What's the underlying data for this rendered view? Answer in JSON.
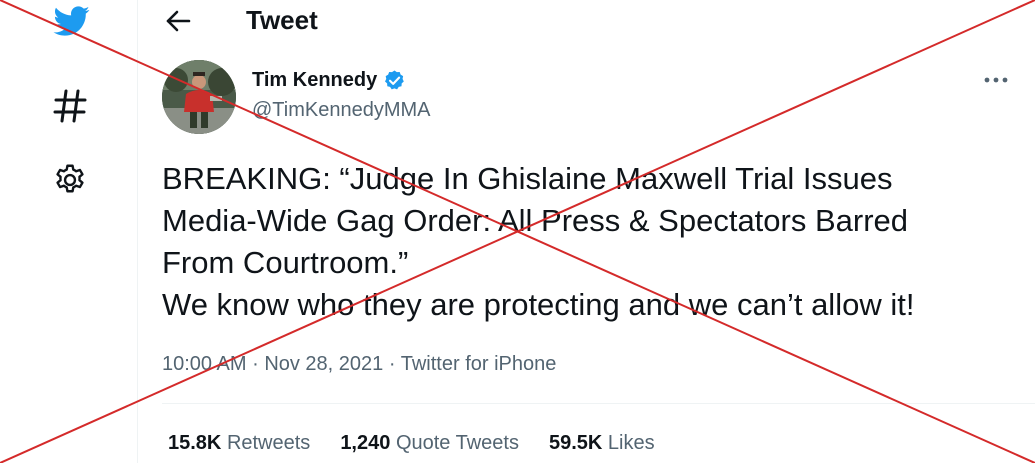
{
  "header": {
    "title": "Tweet",
    "back_icon": "arrow-left-icon"
  },
  "sidebar": {
    "icons": [
      "twitter-bird-icon",
      "hashtag-icon",
      "gear-icon"
    ],
    "brand_color": "#1d9bf0"
  },
  "tweet": {
    "author": {
      "name": "Tim Kennedy",
      "handle": "@TimKennedyMMA",
      "verified": true
    },
    "text_lines": [
      "BREAKING: “Judge In Ghislaine Maxwell Trial Issues",
      "Media-Wide Gag Order: All Press & Spectators Barred",
      "From Courtroom.”",
      "We know who they are protecting and we can’t allow it!"
    ],
    "time": "10:00 AM",
    "date": "Nov 28, 2021",
    "source": "Twitter for iPhone",
    "separator": "·",
    "stats": {
      "retweets_count": "15.8K",
      "retweets_label": "Retweets",
      "quotes_count": "1,240",
      "quotes_label": "Quote Tweets",
      "likes_count": "59.5K",
      "likes_label": "Likes"
    }
  },
  "overlay": {
    "type": "red-x-cross",
    "color": "#d42a2a"
  }
}
